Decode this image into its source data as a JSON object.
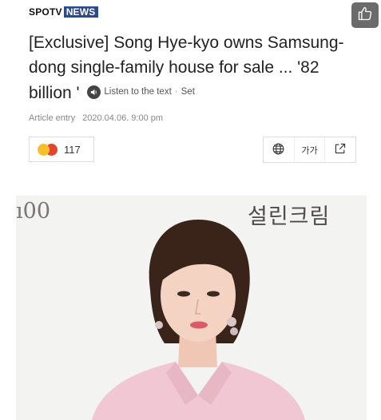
{
  "brand": {
    "part1": "SPOTV",
    "part2": "NEWS"
  },
  "like_button": {
    "icon": "thumbs-up-icon"
  },
  "article": {
    "headline": "[Exclusive] Song Hye-kyo owns Samsung-dong single-family house for sale ... '82 billion '",
    "listen_label": "Listen to the text",
    "listen_separator": "·",
    "set_label": "Set",
    "meta_label": "Article entry",
    "meta_date": "2020.04.06. 9:00 pm"
  },
  "reactions": {
    "count": "117",
    "emoji_colors": [
      "#f6c02a",
      "#e2462d"
    ]
  },
  "toolbar": {
    "globe_icon": "globe-icon",
    "font_size_label": "가가",
    "share_icon": "share-icon"
  },
  "photo": {
    "text_left": "ı00",
    "text_right": "설린크림"
  }
}
